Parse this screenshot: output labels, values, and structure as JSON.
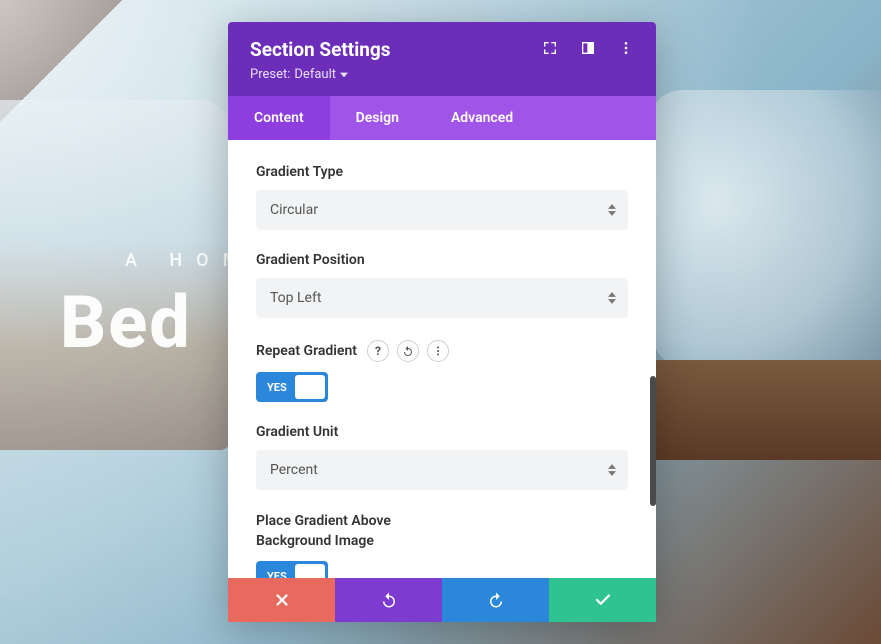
{
  "background": {
    "tagline": "A HOM",
    "headline": "Bed"
  },
  "modal": {
    "title": "Section Settings",
    "preset_prefix": "Preset:",
    "preset_value": "Default",
    "tabs": {
      "content": "Content",
      "design": "Design",
      "advanced": "Advanced",
      "active": "content"
    },
    "fields": {
      "gradient_type": {
        "label": "Gradient Type",
        "value": "Circular"
      },
      "gradient_position": {
        "label": "Gradient Position",
        "value": "Top Left"
      },
      "repeat_gradient": {
        "label": "Repeat Gradient",
        "value": "YES"
      },
      "gradient_unit": {
        "label": "Gradient Unit",
        "value": "Percent"
      },
      "place_above": {
        "label_line1": "Place Gradient Above",
        "label_line2": "Background Image",
        "value": "YES"
      }
    }
  }
}
